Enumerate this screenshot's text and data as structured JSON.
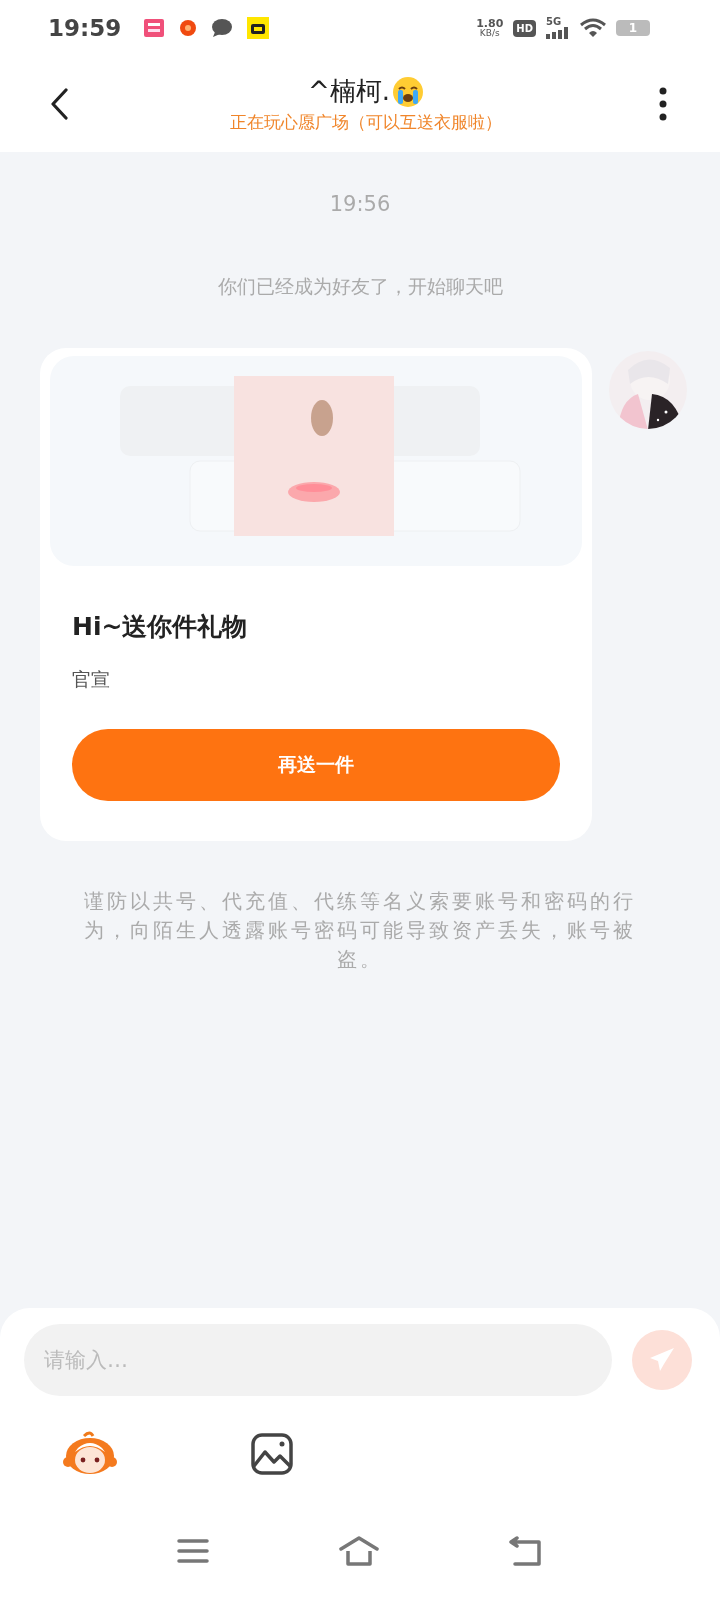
{
  "status_bar": {
    "time": "19:59",
    "speed_value": "1.80",
    "speed_unit": "KB/s",
    "hd_badge": "HD",
    "network": "5G",
    "battery": "1"
  },
  "header": {
    "title": "^楠柯.",
    "subtitle": "正在玩心愿广场（可以互送衣服啦）"
  },
  "messages": [
    {
      "kind": "time",
      "text": "19:56"
    },
    {
      "kind": "system",
      "text": "你们已经成为好友了，开始聊天吧"
    },
    {
      "kind": "gift",
      "title": "Hi~送你件礼物",
      "description": "官宣",
      "button": "再送一件"
    },
    {
      "kind": "warning",
      "text": "谨防以共号、代充值、代练等名义索要账号和密码的行为，向陌生人透露账号密码可能导致资产丢失，账号被盗。"
    }
  ],
  "composer": {
    "placeholder": "请输入…"
  }
}
